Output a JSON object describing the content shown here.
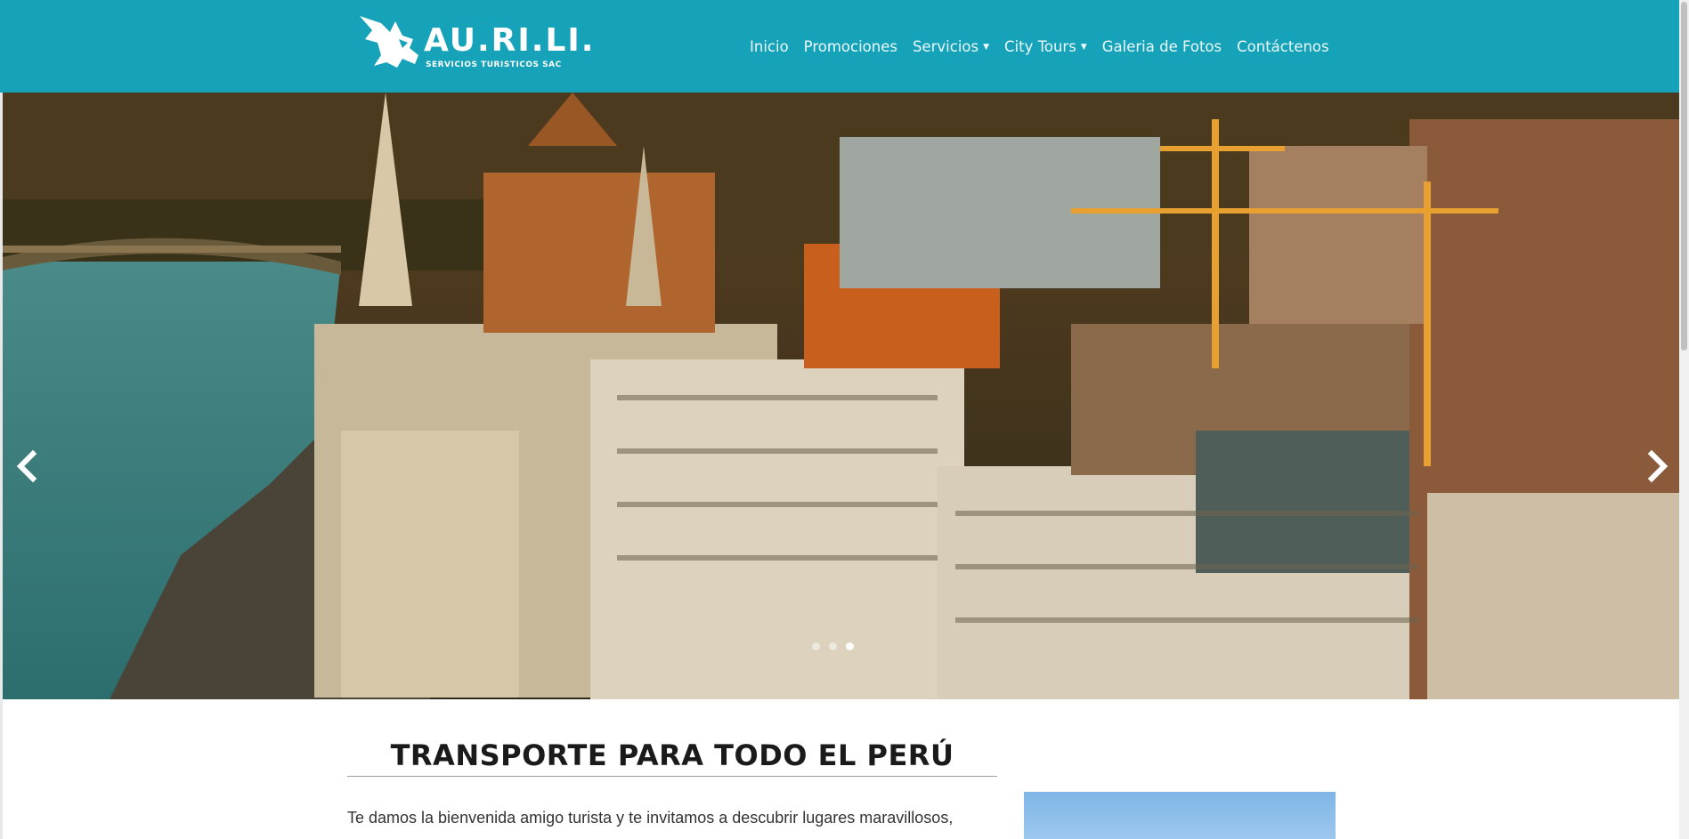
{
  "brand": {
    "name": "AU.RI.LI.",
    "tagline": "SERVICIOS TURISTICOS SAC",
    "color": "#16a2b8"
  },
  "nav": {
    "items": [
      {
        "label": "Inicio"
      },
      {
        "label": "Promociones"
      },
      {
        "label": "Servicios",
        "dropdown": true
      },
      {
        "label": "City Tours",
        "dropdown": true
      },
      {
        "label": "Galeria de Fotos"
      },
      {
        "label": "Contáctenos"
      }
    ]
  },
  "carousel": {
    "prev_icon": "chevron-left-icon",
    "next_icon": "chevron-right-icon",
    "slide_count": 3,
    "active_index": 2
  },
  "main": {
    "title": "TRANSPORTE PARA TODO EL PERÚ",
    "intro": "Te damos la bienvenida amigo turista y te invitamos a descubrir lugares maravillosos,"
  }
}
